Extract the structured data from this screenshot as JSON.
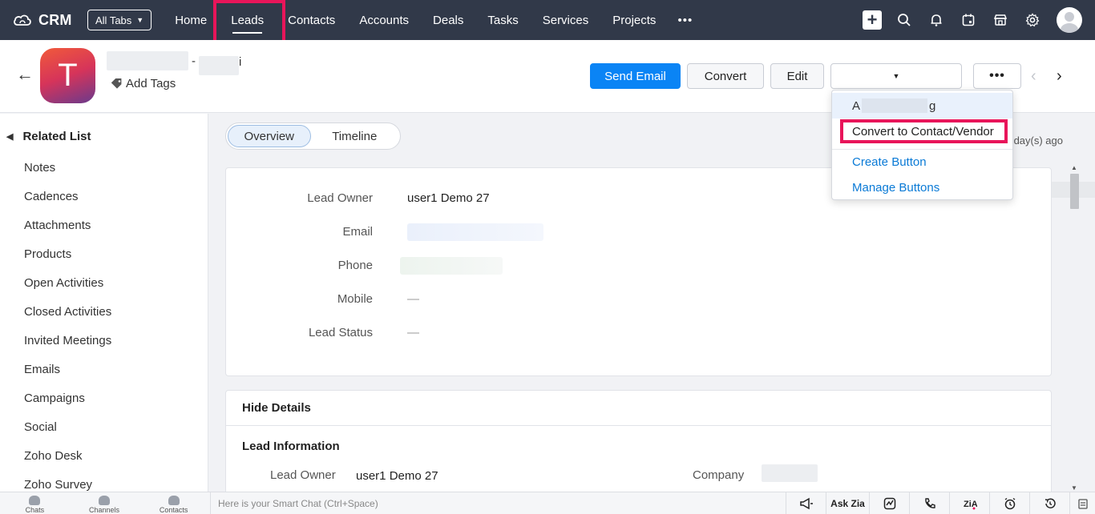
{
  "topnav": {
    "logo_text": "CRM",
    "alltabs_label": "All Tabs",
    "links": [
      "Home",
      "Leads",
      "Contacts",
      "Accounts",
      "Deals",
      "Tasks",
      "Services",
      "Projects"
    ],
    "more_label": "•••",
    "icons": [
      "plus-icon",
      "search-icon",
      "bell-icon",
      "calendar-icon",
      "store-icon",
      "gear-icon",
      "profile-avatar"
    ]
  },
  "record": {
    "avatar_letter": "T",
    "name_separator": "-",
    "name_tail": "i",
    "add_tags_label": "Add Tags",
    "buttons": {
      "send_email": "Send Email",
      "convert": "Convert",
      "edit": "Edit",
      "more": "•••"
    }
  },
  "dropdown": {
    "first_prefix": "A",
    "first_suffix": "g",
    "convert_label": "Convert to Contact/Vendor",
    "create_button": "Create Button",
    "manage_buttons": "Manage Buttons"
  },
  "sidebar": {
    "title": "Related List",
    "items": [
      "Notes",
      "Cadences",
      "Attachments",
      "Products",
      "Open Activities",
      "Closed Activities",
      "Invited Meetings",
      "Emails",
      "Campaigns",
      "Social",
      "Zoho Desk",
      "Zoho Survey"
    ]
  },
  "main": {
    "tabs": [
      "Overview",
      "Timeline"
    ],
    "modified_suffix": "day(s) ago",
    "overview_fields": [
      {
        "label": "Lead Owner",
        "value": "user1 Demo 27"
      },
      {
        "label": "Email",
        "value": ""
      },
      {
        "label": "Phone",
        "value": ""
      },
      {
        "label": "Mobile",
        "value": "—"
      },
      {
        "label": "Lead Status",
        "value": "—"
      }
    ],
    "hide_details": "Hide Details",
    "lead_info_title": "Lead Information",
    "lead_info": {
      "owner_label": "Lead Owner",
      "owner_value": "user1 Demo 27",
      "company_label": "Company"
    }
  },
  "bottombar": {
    "left_items": [
      "Chats",
      "Channels",
      "Contacts"
    ],
    "smartchat_placeholder": "Here is your Smart Chat (Ctrl+Space)",
    "ask_zia": "Ask Zia"
  },
  "colors": {
    "nav_bg": "#313949",
    "primary": "#0a84f5",
    "highlight": "#e8155a",
    "link": "#0a7ad6"
  }
}
